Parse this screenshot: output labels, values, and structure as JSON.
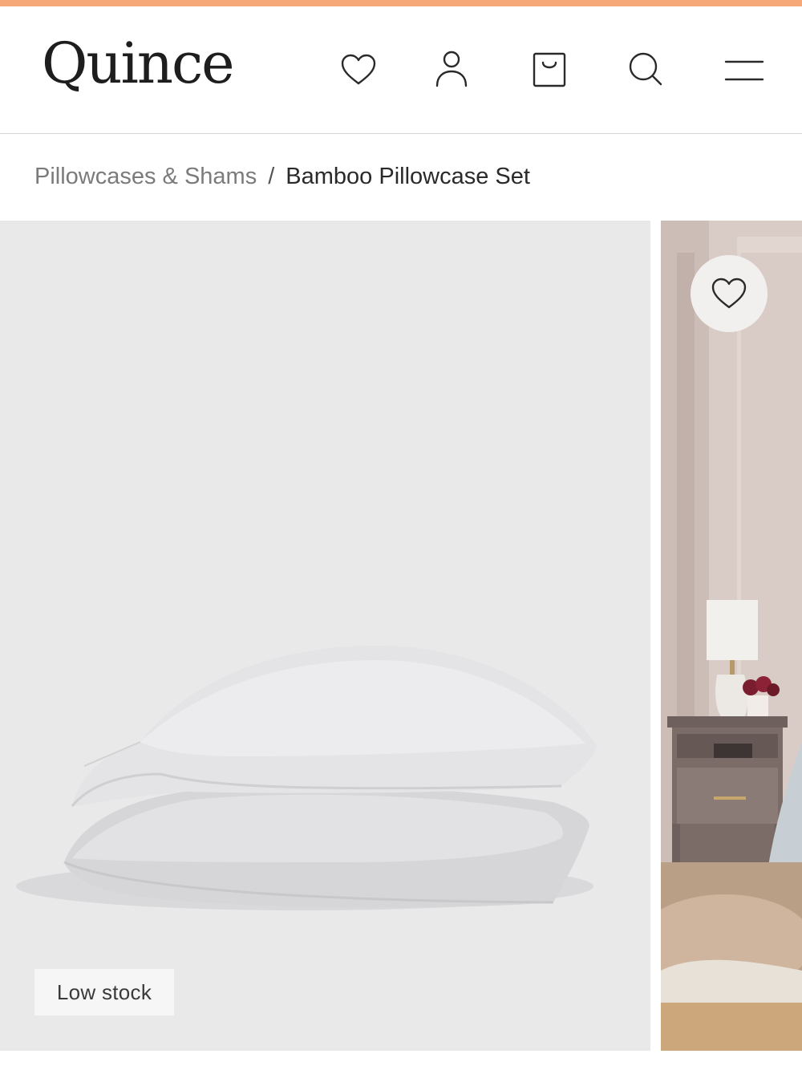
{
  "colors": {
    "accent_bar": "#f6a878",
    "text_primary": "#2a2a2a",
    "text_muted": "#7b7b7b",
    "image_background": "#e9e9ea"
  },
  "header": {
    "logo": "Quince",
    "icons": [
      "heart-icon",
      "account-icon",
      "shopping-bag-icon",
      "search-icon",
      "menu-icon"
    ]
  },
  "breadcrumb": {
    "parent": "Pillowcases & Shams",
    "separator": "/",
    "current": "Bamboo Pillowcase Set"
  },
  "gallery": {
    "slides": [
      {
        "badge": "Low stock"
      },
      {
        "wishlist_icon": "heart-icon"
      }
    ]
  }
}
